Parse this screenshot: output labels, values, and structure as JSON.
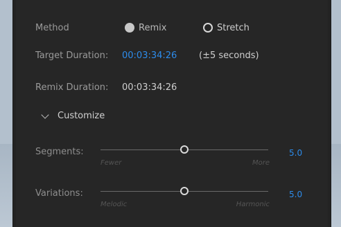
{
  "method": {
    "label": "Method",
    "options": [
      {
        "label": "Remix",
        "selected": true
      },
      {
        "label": "Stretch",
        "selected": false
      }
    ]
  },
  "target_duration": {
    "label": "Target Duration:",
    "value": "00:03:34:26",
    "note": "(±5 seconds)"
  },
  "remix_duration": {
    "label": "Remix Duration:",
    "value": "00:03:34:26"
  },
  "customize": {
    "label": "Customize"
  },
  "segments": {
    "label": "Segments:",
    "min_label": "Fewer",
    "max_label": "More",
    "value": "5.0",
    "fraction": 0.5
  },
  "variations": {
    "label": "Variations:",
    "min_label": "Melodic",
    "max_label": "Harmonic",
    "value": "5.0",
    "fraction": 0.5
  },
  "colors": {
    "accent": "#2d8ceb",
    "panel": "#262626"
  }
}
